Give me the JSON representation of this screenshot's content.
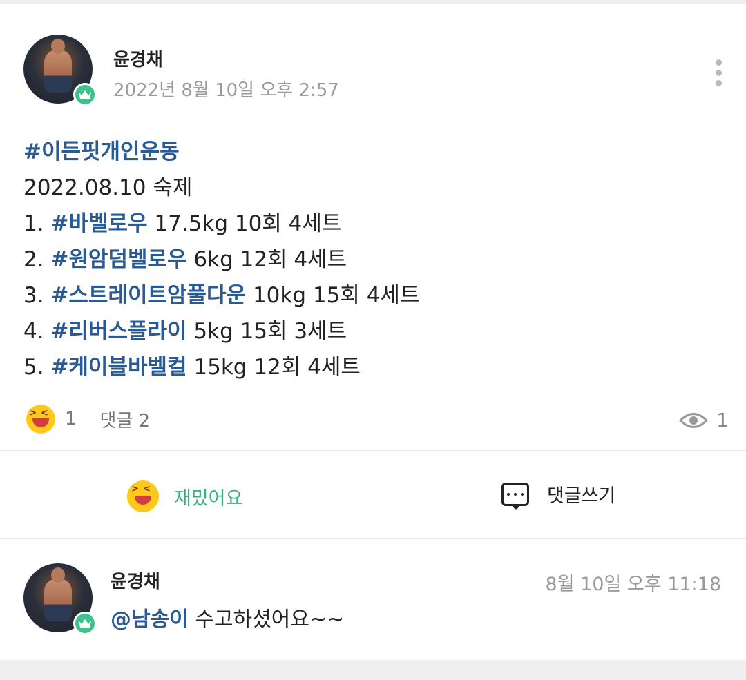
{
  "post": {
    "author": "윤경채",
    "date": "2022년 8월 10일 오후 2:57",
    "hashtag_title": "#이든핏개인운동",
    "subtitle": "2022.08.10 숙제",
    "items": [
      {
        "num": "1. ",
        "tag": "#바벨로우",
        "detail": " 17.5kg 10회 4세트"
      },
      {
        "num": "2. ",
        "tag": "#원암덤벨로우",
        "detail": " 6kg 12회 4세트"
      },
      {
        "num": "3. ",
        "tag": "#스트레이트암풀다운",
        "detail": " 10kg 15회 4세트"
      },
      {
        "num": "4. ",
        "tag": "#리버스플라이",
        "detail": " 5kg 15회 3세트"
      },
      {
        "num": "5. ",
        "tag": "#케이블바벨컬",
        "detail": " 15kg 12회 4세트"
      }
    ],
    "reaction_count": "1",
    "comment_label": "댓글 2",
    "view_count": "1"
  },
  "actions": {
    "like_label": "재밌어요",
    "comment_label": "댓글쓰기"
  },
  "comment": {
    "author": "윤경채",
    "date": "8월 10일 오후 11:18",
    "mention": "@남송이",
    "text": " 수고하셨어요~~"
  },
  "icons": {
    "badge": "crown-icon",
    "menu": "more-vertical-icon",
    "reaction": "laughing-emoji-icon",
    "view": "eye-icon",
    "comment": "speech-bubble-icon"
  },
  "colors": {
    "hashtag": "#2a5a94",
    "like_accent": "#3cb07e",
    "badge": "#3cc28a"
  }
}
